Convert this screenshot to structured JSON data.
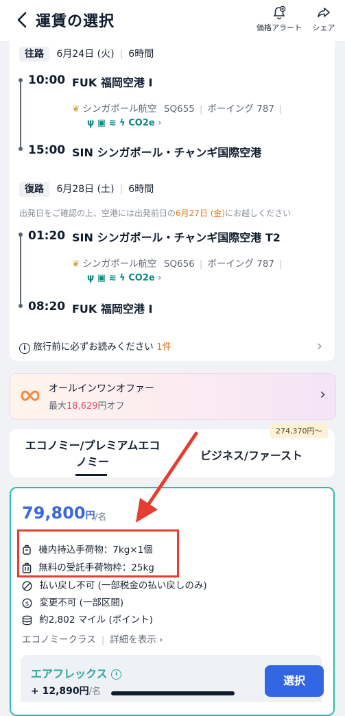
{
  "header": {
    "title": "運賃の選択",
    "price_alert_label": "価格アラート",
    "share_label": "シェア"
  },
  "outbound": {
    "direction": "往路",
    "date": "6月24日 (火)",
    "duration": "6時間",
    "dep_time": "10:00",
    "dep_airport": "FUK 福岡空港 I",
    "airline": "シンガポール航空",
    "flight_no": "SQ655",
    "aircraft": "ボーイング 787",
    "co2": "CO2e",
    "arr_time": "15:00",
    "arr_airport": "SIN シンガポール・チャンギ国際空港"
  },
  "inbound": {
    "direction": "復路",
    "date": "6月28日 (土)",
    "duration": "6時間",
    "notice_pre": "出発日をご確認の上、空港には出発前日の",
    "notice_date": "6月27日 (金)",
    "notice_post": "にお越しください",
    "dep_time": "01:20",
    "dep_airport": "SIN シンガポール・チャンギ国際空港 T2",
    "airline": "シンガポール航空",
    "flight_no": "SQ656",
    "aircraft": "ボーイング 787",
    "co2": "CO2e",
    "arr_time": "08:20",
    "arr_airport": "FUK 福岡空港 I"
  },
  "readme": {
    "label": "旅行前に必ずお読みください",
    "count": "1件"
  },
  "offer": {
    "title": "オールインワンオファー",
    "prefix": "最大",
    "amount": "18,629",
    "suffix": "円オフ"
  },
  "tabs": {
    "economy_line1": "エコノミー/プレミアムエコ",
    "economy_line2": "ノミー",
    "business": "ビジネス/ファースト",
    "business_badge": "274,370円〜"
  },
  "fare": {
    "price": "79,800",
    "currency": "円",
    "per": "/名",
    "features": [
      "機内持込手荷物：7kg×1個",
      "無料の受託手荷物枠：25kg",
      "払い戻し不可 (一部税金の払い戻しのみ)",
      "変更不可 (一部区間)",
      "約2,802 マイル (ポイント)"
    ],
    "class_label": "エコノミークラス",
    "details_link": "詳細を表示",
    "option_name": "エアフレックス",
    "option_price": "+ 12,890円",
    "option_per": "/名",
    "select_label": "選択"
  },
  "colors": {
    "accent": "#3266e3",
    "teal": "#2fb7ae",
    "orange": "#e4791f",
    "annotation_red": "#e53d2f"
  }
}
